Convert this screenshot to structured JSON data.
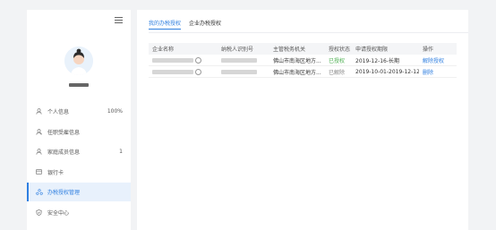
{
  "sidebar": {
    "items": [
      {
        "label": "个人信息",
        "value": "100%",
        "icon": "person-icon"
      },
      {
        "label": "任职受雇信息",
        "value": "",
        "icon": "person-job-icon"
      },
      {
        "label": "家庭成员信息",
        "value": "1",
        "icon": "family-icon"
      },
      {
        "label": "银行卡",
        "value": "",
        "icon": "card-icon"
      },
      {
        "label": "办税授权管理",
        "value": "",
        "icon": "authorization-icon"
      },
      {
        "label": "安全中心",
        "value": "",
        "icon": "shield-icon"
      }
    ],
    "active_index": 4
  },
  "tabs": [
    {
      "label": "我的办税授权"
    },
    {
      "label": "企业办税授权"
    }
  ],
  "table": {
    "headers": [
      "企业名称",
      "纳税人识别号",
      "主管税务机关",
      "授权状态",
      "申请授权期限",
      "操作"
    ],
    "rows": [
      {
        "authority": "佛山市南海区地方...",
        "status": "已授权",
        "period": "2019-12-16-长期",
        "action": "解除授权"
      },
      {
        "authority": "佛山市南海区地方...",
        "status": "已解除",
        "period": "2019-10-01-2019-12-12",
        "action": "删除"
      }
    ]
  },
  "colors": {
    "accent": "#2f7fe0",
    "status_authorized": "#4caf50",
    "status_removed": "#888888"
  }
}
